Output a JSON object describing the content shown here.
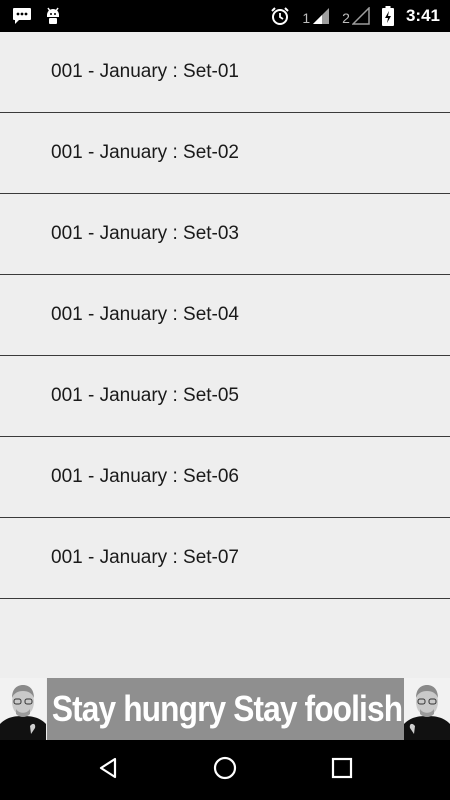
{
  "status_bar": {
    "sim1_label": "1",
    "sim2_label": "2",
    "time": "3:41",
    "icons": [
      "chat-notification-icon",
      "android-debug-icon",
      "alarm-icon",
      "signal-sim1-icon",
      "signal-sim2-icon",
      "battery-charging-icon"
    ]
  },
  "list": {
    "items": [
      {
        "label": "001 - January : Set-01"
      },
      {
        "label": "001 - January : Set-02"
      },
      {
        "label": "001 - January : Set-03"
      },
      {
        "label": "001 - January : Set-04"
      },
      {
        "label": "001 - January : Set-05"
      },
      {
        "label": "001 - January : Set-06"
      },
      {
        "label": "001 - January : Set-07"
      }
    ]
  },
  "banner": {
    "text": "Stay hungry Stay foolish",
    "background_color": "#8f8f8f"
  },
  "nav_bar": {
    "icons": [
      "back-icon",
      "home-icon",
      "recents-icon"
    ]
  }
}
